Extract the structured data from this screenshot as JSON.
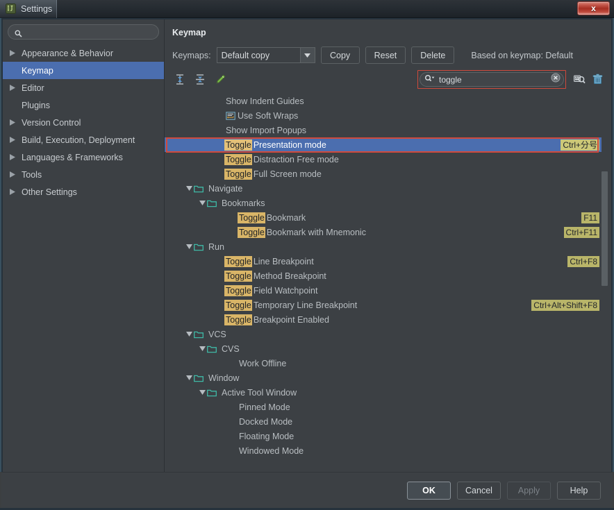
{
  "window": {
    "title": "Settings",
    "app_icon": "intellij-icon",
    "close_label": "x"
  },
  "sidebar": {
    "search": {
      "value": "",
      "placeholder": "",
      "icon": "search-icon"
    },
    "items": [
      {
        "label": "Appearance & Behavior",
        "expandable": true,
        "selected": false
      },
      {
        "label": "Keymap",
        "expandable": false,
        "selected": true
      },
      {
        "label": "Editor",
        "expandable": true,
        "selected": false
      },
      {
        "label": "Plugins",
        "expandable": false,
        "selected": false
      },
      {
        "label": "Version Control",
        "expandable": true,
        "selected": false
      },
      {
        "label": "Build, Execution, Deployment",
        "expandable": true,
        "selected": false
      },
      {
        "label": "Languages & Frameworks",
        "expandable": true,
        "selected": false
      },
      {
        "label": "Tools",
        "expandable": true,
        "selected": false
      },
      {
        "label": "Other Settings",
        "expandable": true,
        "selected": false
      }
    ]
  },
  "main": {
    "title": "Keymap",
    "keymaps_label": "Keymaps:",
    "keymap_selected": "Default copy",
    "buttons": {
      "copy": "Copy",
      "reset": "Reset",
      "delete": "Delete"
    },
    "based_on": "Based on keymap: Default",
    "toolbar": {
      "expand_all": "expand-all-icon",
      "collapse_all": "collapse-all-icon",
      "edit": "edit-pencil-icon",
      "find_by_shortcut": "find-by-shortcut-icon",
      "clear_shortcut": "delete-trash-icon"
    },
    "search": {
      "value": "toggle",
      "icon": "search-dropdown-icon",
      "clear_icon": "clear-circle-icon",
      "highlighted": true
    }
  },
  "tree": {
    "highlight_term": "Toggle",
    "rows": [
      {
        "indent": 4,
        "icon": "none",
        "pre": "",
        "text": "Show Indent Guides",
        "shortcut": "",
        "selected": false,
        "type": "action"
      },
      {
        "indent": 4,
        "icon": "wrap",
        "pre": "",
        "text": "Use Soft Wraps",
        "shortcut": "",
        "selected": false,
        "type": "action"
      },
      {
        "indent": 4,
        "icon": "none",
        "pre": "",
        "text": "Show Import Popups",
        "shortcut": "",
        "selected": false,
        "type": "action"
      },
      {
        "indent": 4,
        "icon": "none",
        "pre": "Toggle",
        "text": "Presentation mode",
        "shortcut": "Ctrl+分号",
        "selected": true,
        "type": "action"
      },
      {
        "indent": 4,
        "icon": "none",
        "pre": "Toggle",
        "text": "Distraction Free mode",
        "shortcut": "",
        "selected": false,
        "type": "action"
      },
      {
        "indent": 4,
        "icon": "none",
        "pre": "Toggle",
        "text": "Full Screen mode",
        "shortcut": "",
        "selected": false,
        "type": "action"
      },
      {
        "indent": 1,
        "icon": "folder",
        "pre": "",
        "text": "Navigate",
        "shortcut": "",
        "selected": false,
        "type": "group"
      },
      {
        "indent": 2,
        "icon": "folder",
        "pre": "",
        "text": "Bookmarks",
        "shortcut": "",
        "selected": false,
        "type": "group"
      },
      {
        "indent": 5,
        "icon": "none",
        "pre": "Toggle",
        "text": "Bookmark",
        "shortcut": "F11",
        "selected": false,
        "type": "action"
      },
      {
        "indent": 5,
        "icon": "none",
        "pre": "Toggle",
        "text": "Bookmark with Mnemonic",
        "shortcut": "Ctrl+F11",
        "selected": false,
        "type": "action"
      },
      {
        "indent": 1,
        "icon": "folder",
        "pre": "",
        "text": "Run",
        "shortcut": "",
        "selected": false,
        "type": "group"
      },
      {
        "indent": 4,
        "icon": "none",
        "pre": "Toggle",
        "text": "Line Breakpoint",
        "shortcut": "Ctrl+F8",
        "selected": false,
        "type": "action"
      },
      {
        "indent": 4,
        "icon": "none",
        "pre": "Toggle",
        "text": "Method Breakpoint",
        "shortcut": "",
        "selected": false,
        "type": "action"
      },
      {
        "indent": 4,
        "icon": "none",
        "pre": "Toggle",
        "text": "Field Watchpoint",
        "shortcut": "",
        "selected": false,
        "type": "action"
      },
      {
        "indent": 4,
        "icon": "none",
        "pre": "Toggle",
        "text": "Temporary Line Breakpoint",
        "shortcut": "Ctrl+Alt+Shift+F8",
        "selected": false,
        "type": "action"
      },
      {
        "indent": 4,
        "icon": "none",
        "pre": "Toggle",
        "text": "Breakpoint Enabled",
        "shortcut": "",
        "selected": false,
        "type": "action"
      },
      {
        "indent": 1,
        "icon": "folder",
        "pre": "",
        "text": "VCS",
        "shortcut": "",
        "selected": false,
        "type": "group"
      },
      {
        "indent": 2,
        "icon": "folder",
        "pre": "",
        "text": "CVS",
        "shortcut": "",
        "selected": false,
        "type": "group"
      },
      {
        "indent": 5,
        "icon": "none",
        "pre": "",
        "text": "Work Offline",
        "shortcut": "",
        "selected": false,
        "type": "action"
      },
      {
        "indent": 1,
        "icon": "folder",
        "pre": "",
        "text": "Window",
        "shortcut": "",
        "selected": false,
        "type": "group"
      },
      {
        "indent": 2,
        "icon": "folder",
        "pre": "",
        "text": "Active Tool Window",
        "shortcut": "",
        "selected": false,
        "type": "group"
      },
      {
        "indent": 5,
        "icon": "none",
        "pre": "",
        "text": "Pinned Mode",
        "shortcut": "",
        "selected": false,
        "type": "action"
      },
      {
        "indent": 5,
        "icon": "none",
        "pre": "",
        "text": "Docked Mode",
        "shortcut": "",
        "selected": false,
        "type": "action"
      },
      {
        "indent": 5,
        "icon": "none",
        "pre": "",
        "text": "Floating Mode",
        "shortcut": "",
        "selected": false,
        "type": "action"
      },
      {
        "indent": 5,
        "icon": "none",
        "pre": "",
        "text": "Windowed Mode",
        "shortcut": "",
        "selected": false,
        "type": "action"
      }
    ]
  },
  "footer": {
    "ok": "OK",
    "cancel": "Cancel",
    "apply": "Apply",
    "help": "Help",
    "apply_disabled": true
  },
  "colors": {
    "panel_bg": "#3c4044",
    "selection_blue": "#4b6eaf",
    "match_highlight": "#d9b567",
    "shortcut_highlight": "#b9b569",
    "annotation_red": "#d04a3c",
    "folder_teal": "#3fb9a6"
  }
}
